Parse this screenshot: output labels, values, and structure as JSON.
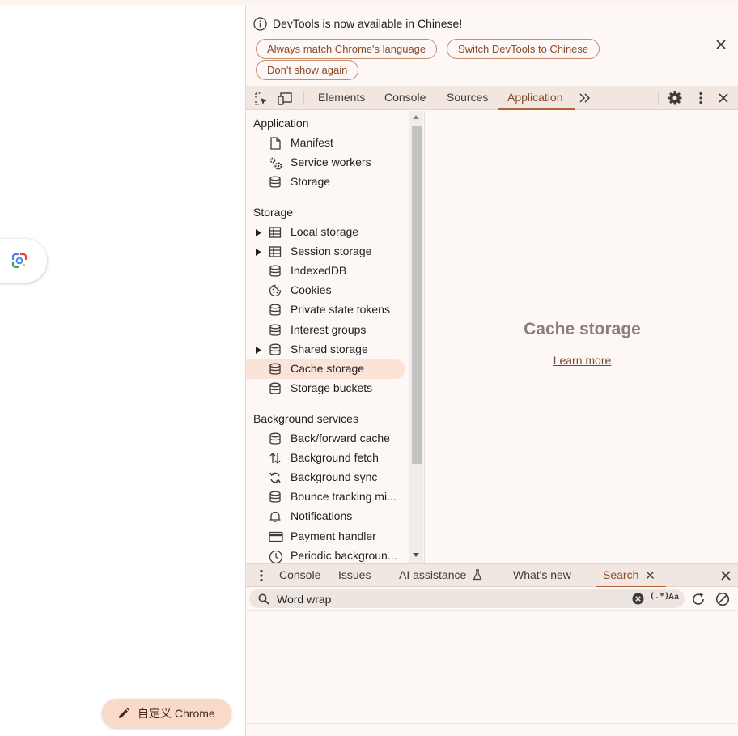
{
  "page": {
    "lens_icon": "google-lens-icon",
    "customize_button": {
      "label": "自定义 Chrome",
      "icon": "pencil-icon"
    }
  },
  "devtools": {
    "infobar": {
      "message": "DevTools is now available in Chinese!",
      "buttons": [
        "Always match Chrome's language",
        "Switch DevTools to Chinese",
        "Don't show again"
      ]
    },
    "main_tabs": [
      "Elements",
      "Console",
      "Sources",
      "Application"
    ],
    "active_main_tab": "Application",
    "sidebar": {
      "sections": [
        {
          "title": "Application",
          "items": [
            {
              "label": "Manifest",
              "icon": "file-icon"
            },
            {
              "label": "Service workers",
              "icon": "gears-icon"
            },
            {
              "label": "Storage",
              "icon": "database-icon"
            }
          ]
        },
        {
          "title": "Storage",
          "items": [
            {
              "label": "Local storage",
              "icon": "table-icon",
              "expandable": true
            },
            {
              "label": "Session storage",
              "icon": "table-icon",
              "expandable": true
            },
            {
              "label": "IndexedDB",
              "icon": "database-icon"
            },
            {
              "label": "Cookies",
              "icon": "cookie-icon"
            },
            {
              "label": "Private state tokens",
              "icon": "database-icon"
            },
            {
              "label": "Interest groups",
              "icon": "database-icon"
            },
            {
              "label": "Shared storage",
              "icon": "database-icon",
              "expandable": true
            },
            {
              "label": "Cache storage",
              "icon": "database-icon",
              "selected": true
            },
            {
              "label": "Storage buckets",
              "icon": "database-icon"
            }
          ]
        },
        {
          "title": "Background services",
          "items": [
            {
              "label": "Back/forward cache",
              "icon": "database-icon"
            },
            {
              "label": "Background fetch",
              "icon": "up-down-arrows-icon"
            },
            {
              "label": "Background sync",
              "icon": "sync-icon"
            },
            {
              "label": "Bounce tracking mi...",
              "icon": "database-icon"
            },
            {
              "label": "Notifications",
              "icon": "bell-icon"
            },
            {
              "label": "Payment handler",
              "icon": "credit-card-icon"
            },
            {
              "label": "Periodic backgroun...",
              "icon": "clock-icon"
            }
          ]
        }
      ]
    },
    "content": {
      "title": "Cache storage",
      "link": "Learn more"
    },
    "drawer": {
      "tabs": [
        "Console",
        "Issues",
        "AI assistance",
        "What's new",
        "Search"
      ],
      "active_tab": "Search",
      "search": {
        "value": "Word wrap",
        "placeholder": "",
        "regex_label": "(.*)",
        "case_label": "Aa"
      }
    },
    "colors": {
      "accent": "#b5613a",
      "accent_text": "#8a4a2a",
      "selected_bg": "#fbe3d7"
    }
  }
}
